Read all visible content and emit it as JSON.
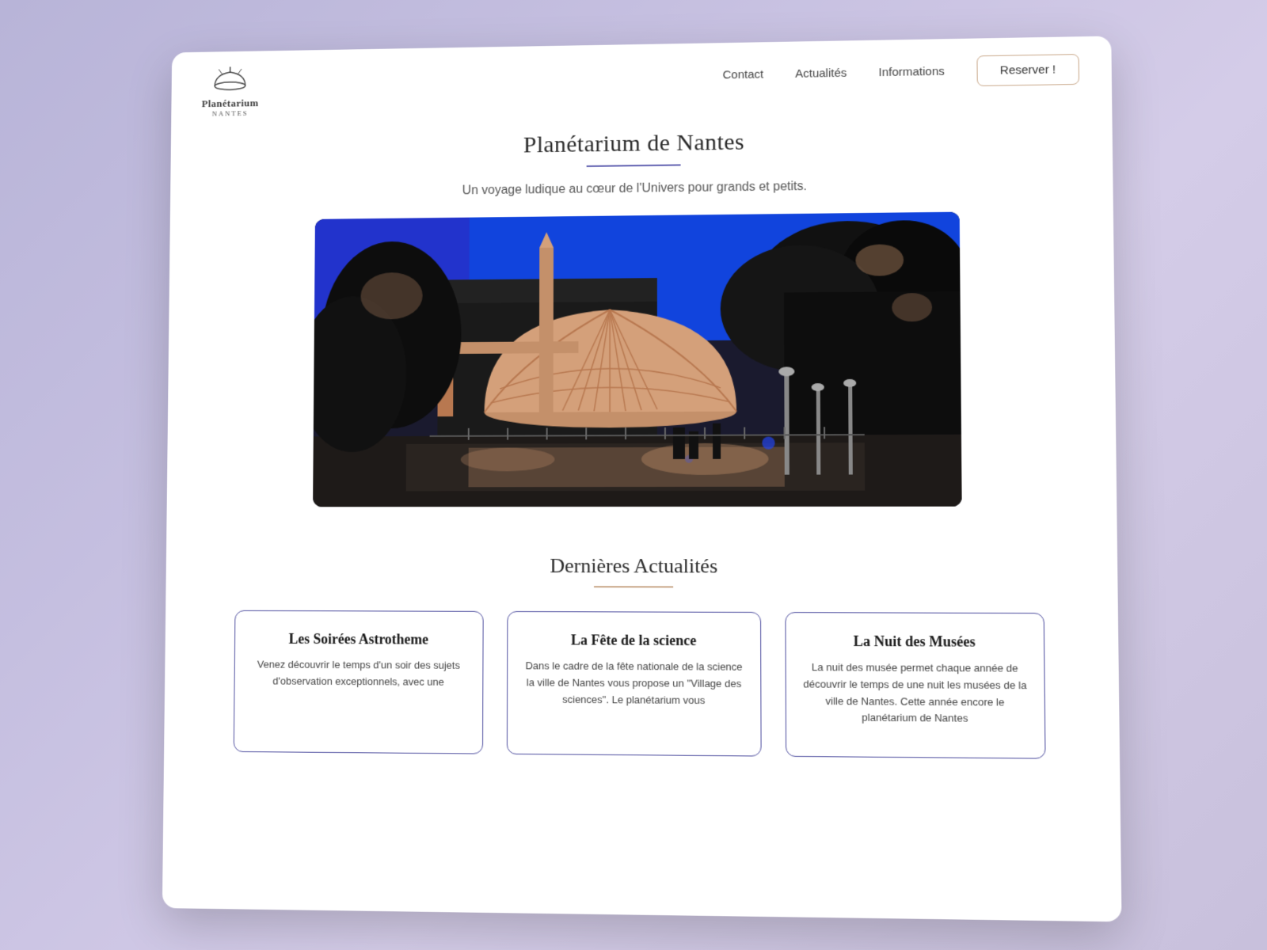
{
  "nav": {
    "logo_main": "Planétarium",
    "logo_sub": "NANTES",
    "links": [
      {
        "id": "contact",
        "label": "Contact"
      },
      {
        "id": "actualites",
        "label": "Actualités"
      },
      {
        "id": "informations",
        "label": "Informations"
      }
    ],
    "reserve_btn": "Reserver !"
  },
  "hero": {
    "title": "Planétarium de Nantes",
    "subtitle": "Un voyage ludique au cœur de l'Univers pour grands et petits."
  },
  "actualites": {
    "section_title": "Dernières Actualités",
    "cards": [
      {
        "id": "astrotheme",
        "title": "Les Soirées Astrotheme",
        "text": "Venez découvrir le temps d'un soir des sujets d'observation exceptionnels, avec une"
      },
      {
        "id": "fete-science",
        "title": "La Fête de la science",
        "text": "Dans le cadre de la fête nationale de la science la ville de Nantes vous propose un \"Village des sciences\". Le planétarium vous"
      },
      {
        "id": "nuit-musees",
        "title": "La Nuit des Musées",
        "text": "La nuit des musée permet chaque année de découvrir le temps de une nuit les musées de la ville de Nantes. Cette année encore le planétarium de Nantes"
      }
    ]
  }
}
